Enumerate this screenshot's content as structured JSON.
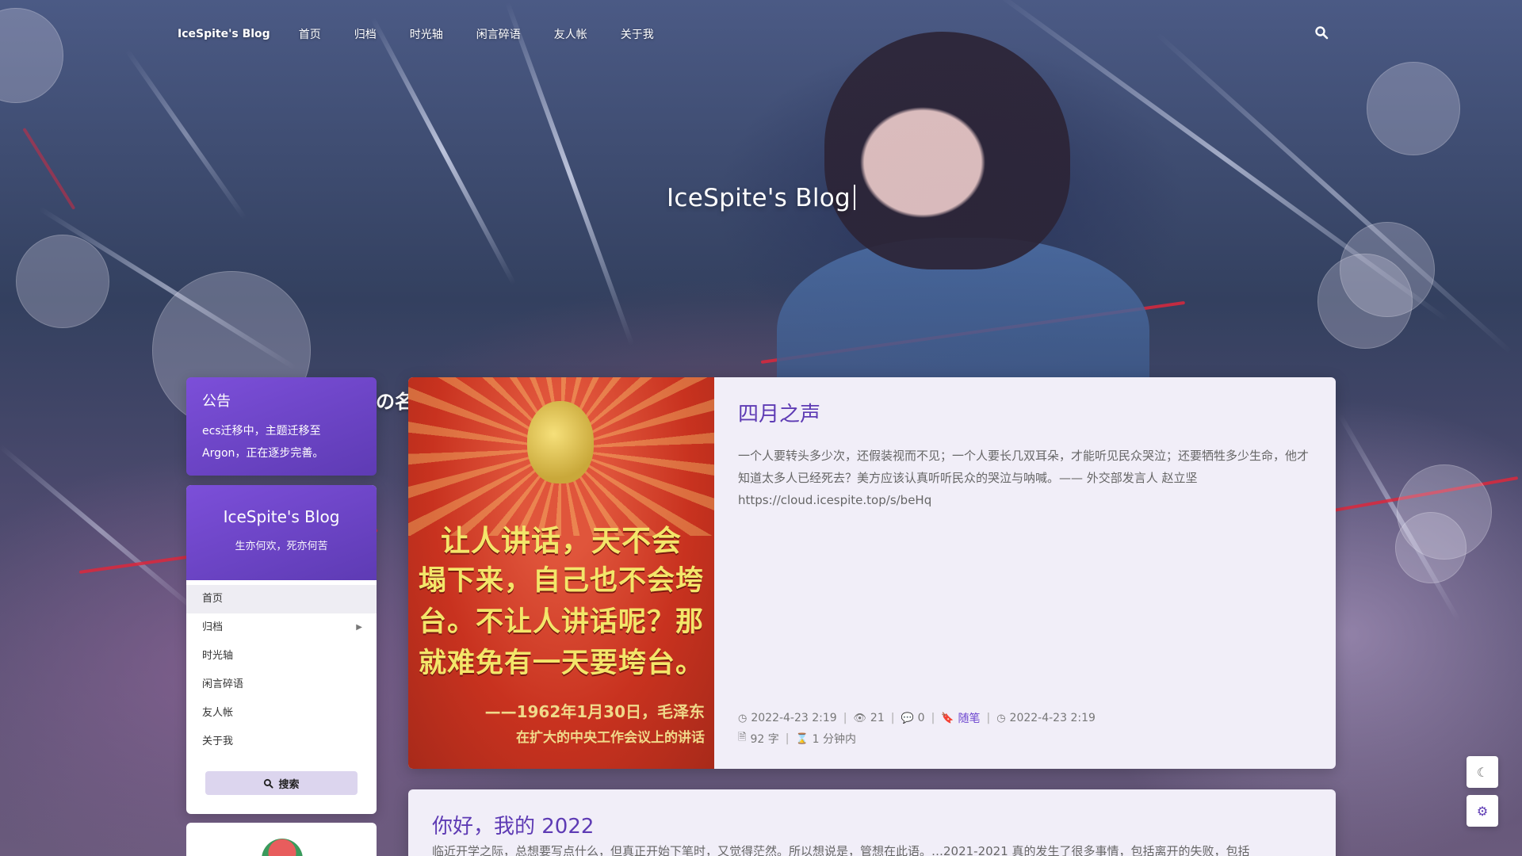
{
  "nav": {
    "brand": "IceSpite's Blog",
    "items": [
      "首页",
      "归档",
      "时光轴",
      "闲言碎语",
      "友人帐",
      "关于我"
    ]
  },
  "hero": {
    "title": "IceSpite's Blog",
    "fragment": "の名"
  },
  "notice": {
    "title": "公告",
    "text": "ecs迁移中，主题迁移至Argon，正在逐步完善。"
  },
  "sidebar": {
    "title": "IceSpite's Blog",
    "subtitle": "生亦何欢，死亦何苦",
    "menu": [
      {
        "label": "首页"
      },
      {
        "label": "归档"
      },
      {
        "label": "时光轴"
      },
      {
        "label": "闲言碎语"
      },
      {
        "label": "友人帐"
      },
      {
        "label": "关于我"
      }
    ],
    "search_label": "搜索"
  },
  "posts": [
    {
      "title": "四月之声",
      "excerpt": "一个人要转头多少次，还假装视而不见；一个人要长几双耳朵，才能听见民众哭泣；还要牺牲多少生命，他才知道太多人已经死去？美方应该认真听听民众的哭泣与呐喊。—— 外交部发言人 赵立坚 https://cloud.icespite.top/s/beHq",
      "image_text": {
        "line1": "让人讲话，天不会",
        "line2": "塌下来，自己也不会垮",
        "line3": "台。不让人讲话呢？那",
        "line4": "就难免有一天要垮台。",
        "credit1": "——1962年1月30日，毛泽东",
        "credit2": "在扩大的中央工作会议上的讲话"
      },
      "meta": {
        "date": "2022-4-23 2:19",
        "views": "21",
        "comments": "0",
        "category": "随笔",
        "modified": "2022-4-23 2:19",
        "words": "92 字",
        "read_time": "1 分钟内"
      }
    },
    {
      "title": "你好，我的 2022",
      "excerpt": "临近开学之际，总想要写点什么，但真正开始下笔时，又觉得茫然。所以想说是，管想在此语。…2021-2021 真的发生了很多事情，包括离开的失败，包括"
    }
  ],
  "colors": {
    "accent": "#5e3bb4",
    "accent_light": "#7c4fd9",
    "card_bg": "#f1eef8"
  },
  "icons": {
    "search": "search-icon",
    "moon": "moon-icon",
    "settings": "gear-icon"
  }
}
